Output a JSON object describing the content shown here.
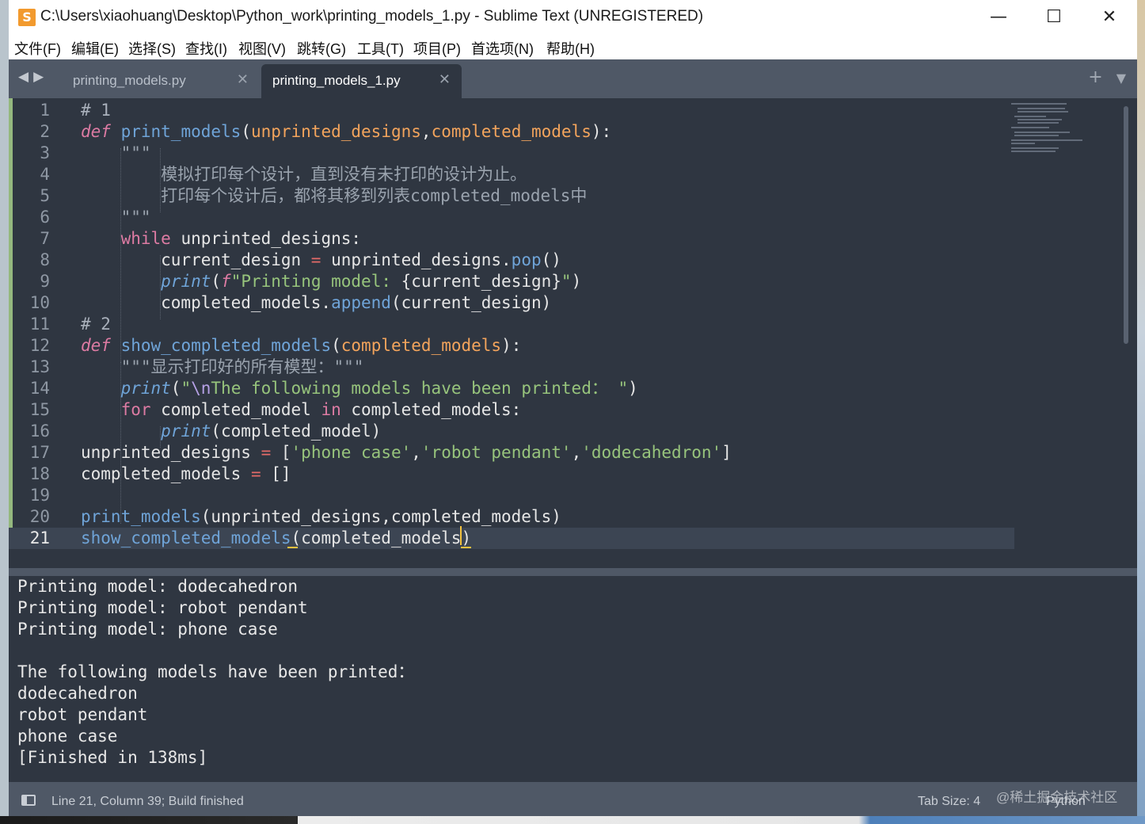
{
  "window": {
    "title": "C:\\Users\\xiaohuang\\Desktop\\Python_work\\printing_models_1.py - Sublime Text (UNREGISTERED)",
    "app_icon": "sublime-text-icon",
    "minimize": "—",
    "maximize": "☐",
    "close": "✕"
  },
  "menu": [
    "文件(F)",
    "编辑(E)",
    "选择(S)",
    "查找(I)",
    "视图(V)",
    "跳转(G)",
    "工具(T)",
    "项目(P)",
    "首选项(N)",
    "帮助(H)"
  ],
  "tabs": [
    {
      "label": "printing_models.py",
      "active": false,
      "close": "✕"
    },
    {
      "label": "printing_models_1.py",
      "active": true,
      "close": "✕"
    }
  ],
  "tabbar": {
    "nav": "◀▶",
    "new_tab": "+",
    "dropdown": "▼"
  },
  "editor": {
    "current_line": 21,
    "line_numbers": [
      "1",
      "2",
      "3",
      "4",
      "5",
      "6",
      "7",
      "8",
      "9",
      "10",
      "11",
      "12",
      "13",
      "14",
      "15",
      "16",
      "17",
      "18",
      "19",
      "20",
      "21"
    ]
  },
  "output": {
    "lines": [
      "Printing model: dodecahedron",
      "Printing model: robot pendant",
      "Printing model: phone case",
      "",
      "The following models have been printed：",
      "dodecahedron",
      "robot pendant",
      "phone case",
      "[Finished in 138ms]"
    ]
  },
  "status": {
    "position": "Line 21, Column 39; Build finished",
    "tab_size": "Tab Size: 4",
    "syntax": "Python",
    "watermark": "@稀土掘金技术社区"
  },
  "colors": {
    "editor_bg": "#2f3641",
    "chrome_bg": "#4f5866",
    "keyword": "#dd7ba3",
    "function": "#6fa4d8",
    "parameter": "#f3a45c",
    "string": "#97c47c",
    "operator": "#e46b69",
    "caret": "#f2c13e"
  }
}
